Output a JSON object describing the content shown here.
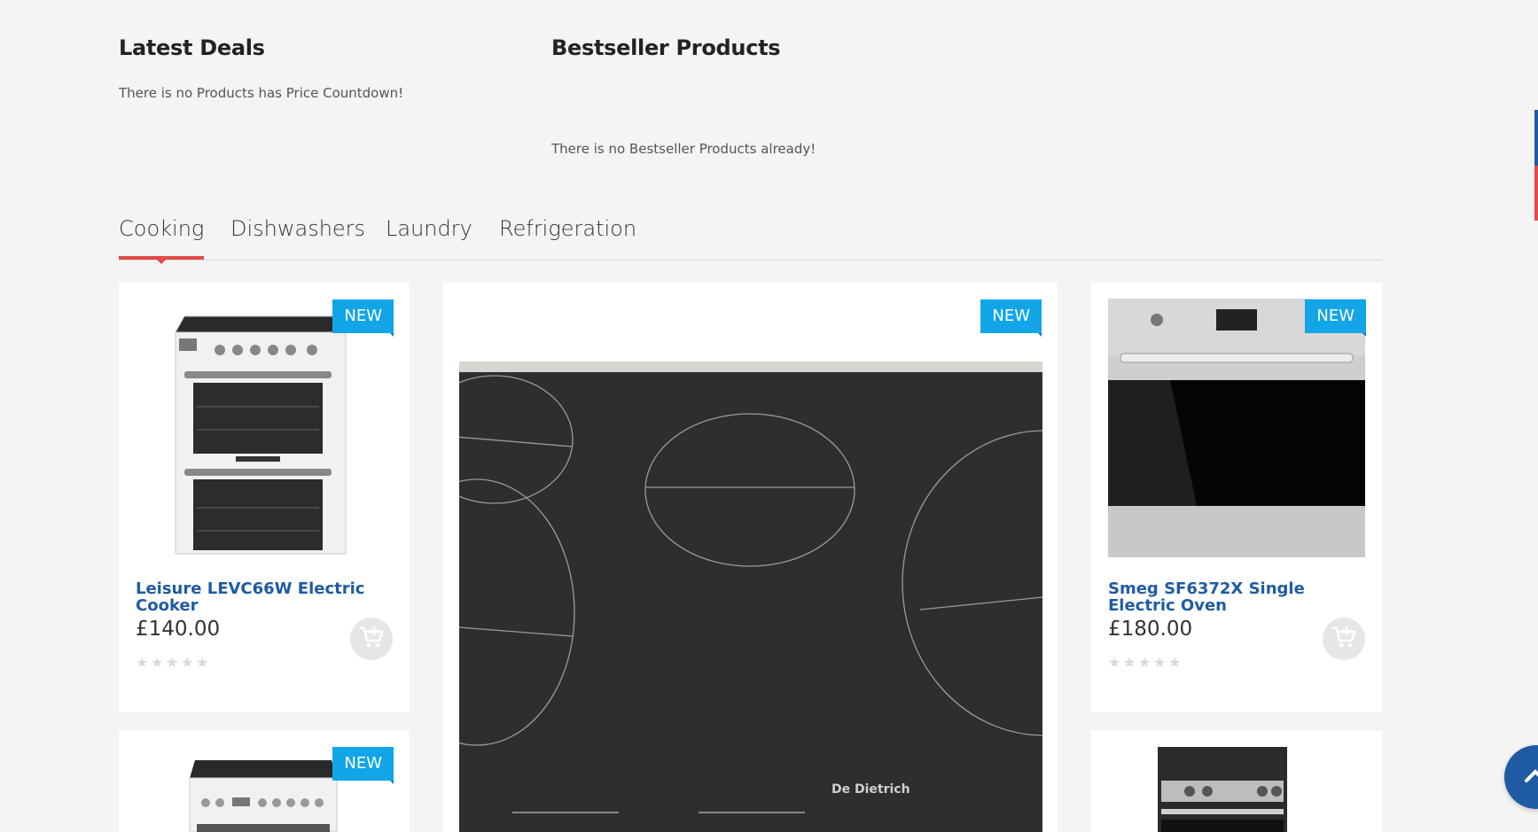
{
  "latest_deals": {
    "title": "Latest Deals",
    "message": "There is no Products has Price Countdown!"
  },
  "bestseller": {
    "title": "Bestseller Products",
    "message": "There is no Bestseller Products already!"
  },
  "tabs": [
    {
      "label": "Cooking",
      "active": true
    },
    {
      "label": "Dishwashers",
      "active": false
    },
    {
      "label": "Laundry",
      "active": false
    },
    {
      "label": "Refrigeration",
      "active": false
    }
  ],
  "products": [
    {
      "badge": "NEW",
      "name": "Leisure LEVC66W Electric Cooker",
      "price": "£140.00",
      "rating": 0,
      "image": "white-freestanding-electric-cooker"
    },
    {
      "badge": "NEW",
      "name": "",
      "price": "",
      "rating": 0,
      "image": "black-ceramic-hob-de-dietrich"
    },
    {
      "badge": "NEW",
      "name": "Smeg SF6372X Single Electric Oven",
      "price": "£180.00",
      "rating": 0,
      "image": "stainless-built-in-oven"
    },
    {
      "badge": "NEW",
      "image": "white-electric-cooker-partial"
    },
    {
      "image": "built-in-double-oven-partial"
    }
  ],
  "hob_brand_text": "De Dietrich",
  "colors": {
    "accent_red": "#e24b47",
    "badge_blue": "#12a5e8",
    "link_blue": "#1f5ba3"
  },
  "icons": {
    "cart": "add-to-cart-icon",
    "back_to_top": "chevron-up-icon",
    "star": "star-icon"
  }
}
